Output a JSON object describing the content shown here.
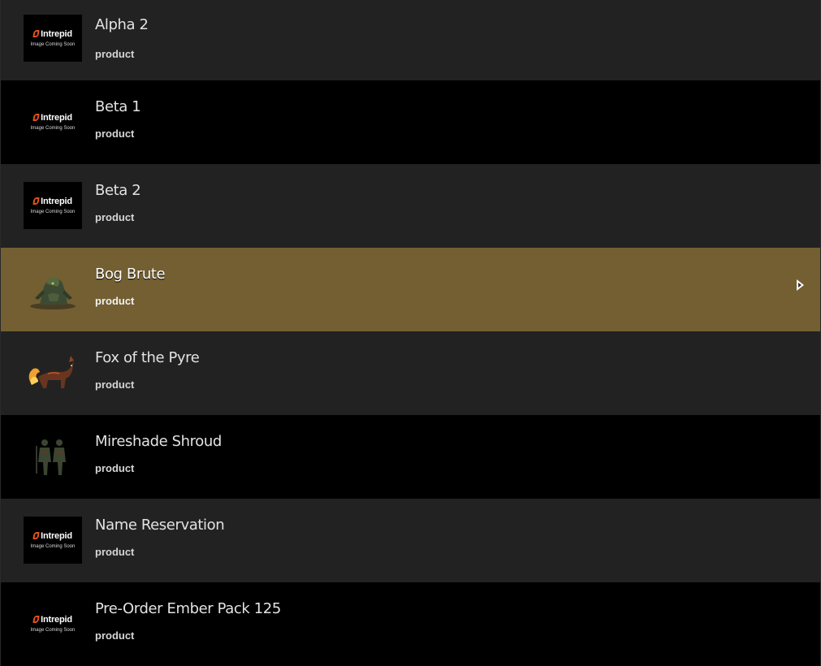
{
  "placeholder": {
    "brand": "Intrepid",
    "caption": "Image Coming Soon"
  },
  "items": [
    {
      "title": "Alpha 2",
      "subtitle": "product",
      "image": "placeholder-logo"
    },
    {
      "title": "Beta 1",
      "subtitle": "product",
      "image": "placeholder-logo"
    },
    {
      "title": "Beta 2",
      "subtitle": "product",
      "image": "placeholder-logo"
    },
    {
      "title": "Bog Brute",
      "subtitle": "product",
      "image": "bog-brute-creature-image",
      "selected": true
    },
    {
      "title": "Fox of the Pyre",
      "subtitle": "product",
      "image": "fire-fox-creature-image"
    },
    {
      "title": "Mireshade Shroud",
      "subtitle": "product",
      "image": "armored-figures-image"
    },
    {
      "title": "Name Reservation",
      "subtitle": "product",
      "image": "placeholder-logo"
    },
    {
      "title": "Pre-Order Ember Pack 125",
      "subtitle": "product",
      "image": "placeholder-logo"
    }
  ],
  "colors": {
    "row_dark": "#222222",
    "row_black": "#000000",
    "row_selected": "#735f31",
    "brand_accent": "#e0541a"
  },
  "selected_indicator_icon": "chevron-right-icon"
}
